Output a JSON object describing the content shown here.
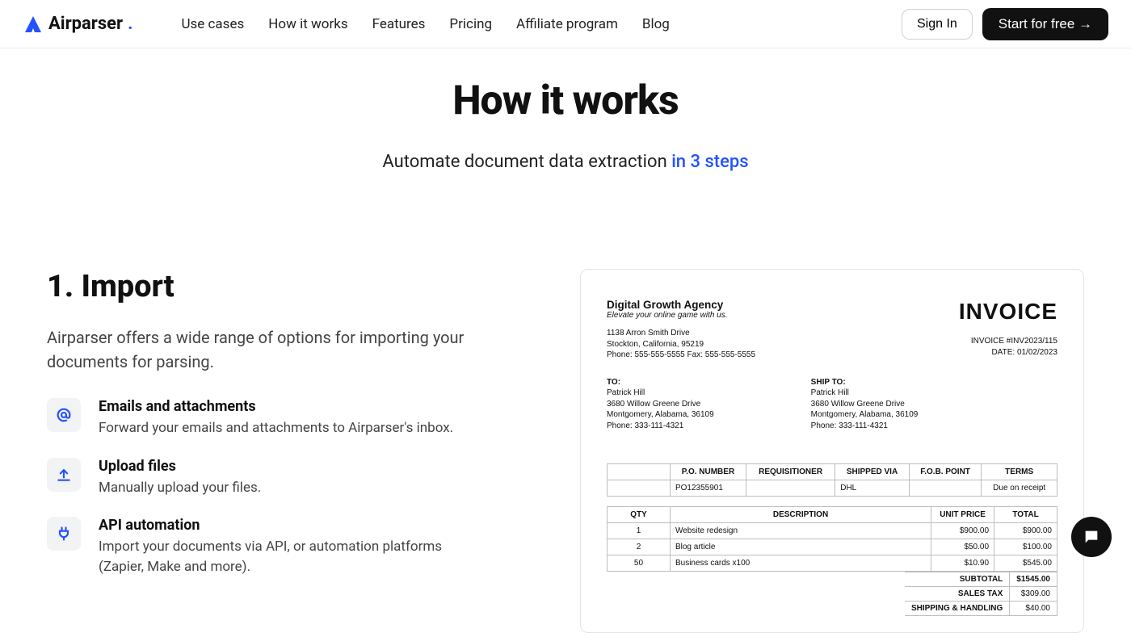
{
  "brand": "Airparser",
  "nav": {
    "items": [
      "Use cases",
      "How it works",
      "Features",
      "Pricing",
      "Affiliate program",
      "Blog"
    ]
  },
  "header_actions": {
    "signin": "Sign In",
    "start": "Start for free →"
  },
  "hero": {
    "title": "How it works",
    "subtitle_pre": "Automate document data extraction ",
    "subtitle_em": "in 3 steps"
  },
  "section": {
    "heading": "1. Import",
    "description": "Airparser offers a wide range of options for importing your documents for parsing.",
    "features": [
      {
        "title": "Emails and attachments",
        "desc": "Forward your emails and attachments to Airparser's inbox."
      },
      {
        "title": "Upload files",
        "desc": "Manually upload your files."
      },
      {
        "title": "API automation",
        "desc": "Import your documents via API, or automation platforms (Zapier, Make and more)."
      }
    ]
  },
  "invoice": {
    "company": "Digital Growth Agency",
    "tagline": "Elevate your online game with us.",
    "addr1": "1138 Arron Smith Drive",
    "addr2": "Stockton, California, 95219",
    "phone": "Phone: 555-555-5555 Fax: 555-555-5555",
    "title": "INVOICE",
    "meta1": "INVOICE #INV2023/115",
    "meta2": "DATE: 01/02/2023",
    "to_label": "TO:",
    "ship_label": "SHIP TO:",
    "to_name": "Patrick Hill",
    "to_addr1": "3680 Willow Greene Drive",
    "to_addr2": "Montgomery, Alabama, 36109",
    "to_phone": "Phone: 333-111-4321",
    "headers1": [
      "P.O. NUMBER",
      "REQUISITIONER",
      "SHIPPED VIA",
      "F.O.B. POINT",
      "TERMS"
    ],
    "row1": [
      "PO12355901",
      "",
      "DHL",
      "",
      "Due on receipt"
    ],
    "headers2": [
      "QTY",
      "DESCRIPTION",
      "UNIT PRICE",
      "TOTAL"
    ],
    "lines": [
      {
        "qty": "1",
        "desc": "Website redesign",
        "unit": "$900.00",
        "total": "$900.00"
      },
      {
        "qty": "2",
        "desc": "Blog article",
        "unit": "$50.00",
        "total": "$100.00"
      },
      {
        "qty": "50",
        "desc": "Business cards x100",
        "unit": "$10.90",
        "total": "$545.00"
      }
    ],
    "totals": [
      {
        "label": "SUBTOTAL",
        "value": "$1545.00"
      },
      {
        "label": "SALES TAX",
        "value": "$309.00"
      },
      {
        "label": "SHIPPING & HANDLING",
        "value": "$40.00"
      }
    ]
  }
}
